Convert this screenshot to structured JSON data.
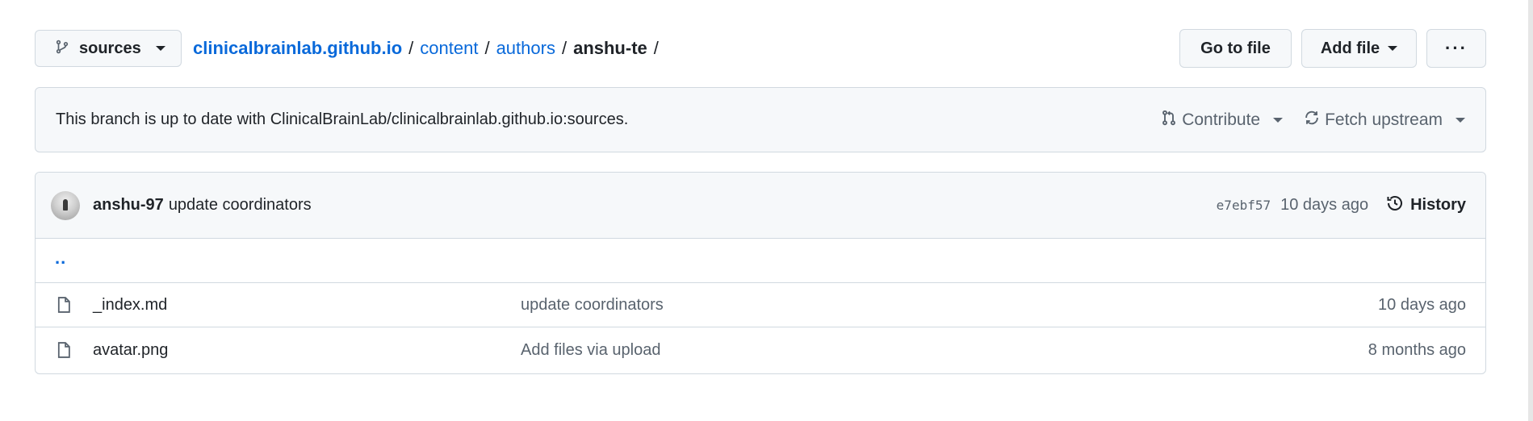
{
  "branch": {
    "name": "sources",
    "icon": "git-branch-icon"
  },
  "breadcrumb": {
    "repo": "clinicalbrainlab.github.io",
    "parts": [
      "content",
      "authors"
    ],
    "current": "anshu-te",
    "separator": "/"
  },
  "actions": {
    "go_to_file": "Go to file",
    "add_file": "Add file",
    "more": "···"
  },
  "status": {
    "text": "This branch is up to date with ClinicalBrainLab/clinicalbrainlab.github.io:sources.",
    "contribute": "Contribute",
    "fetch_upstream": "Fetch upstream"
  },
  "commit": {
    "author": "anshu-97",
    "message": "update coordinators",
    "sha": "e7ebf57",
    "time": "10 days ago",
    "history": "History"
  },
  "parent_link": "..",
  "files": [
    {
      "name": "_index.md",
      "message": "update coordinators",
      "time": "10 days ago",
      "icon": "file-icon"
    },
    {
      "name": "avatar.png",
      "message": "Add files via upload",
      "time": "8 months ago",
      "icon": "file-icon"
    }
  ],
  "colors": {
    "link": "#0969da",
    "muted": "#59636e",
    "border": "#d1d9e0",
    "subtle_bg": "#f6f8fa"
  }
}
